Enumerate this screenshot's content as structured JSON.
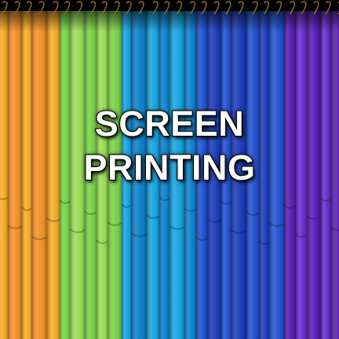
{
  "caption": {
    "line1": "SCREEN",
    "line2": "PRINTING"
  },
  "palette": [
    "#ffb02a",
    "#f9962a",
    "#9fe35a",
    "#7dd84a",
    "#18a9e6",
    "#0f85cf",
    "#2355d8",
    "#1d3fc0",
    "#6b2fd0",
    "#5a1fb8"
  ]
}
